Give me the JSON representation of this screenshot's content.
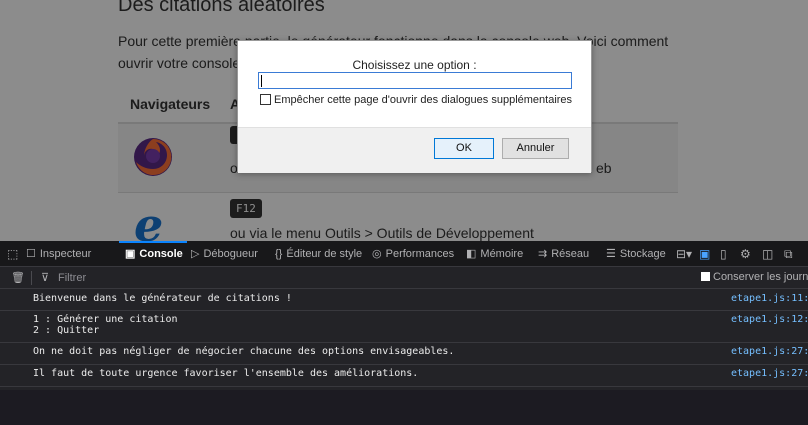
{
  "page": {
    "heading": "Des citations aléatoires",
    "intro_line1": "Pour cette première partie, le générateur fonctionne dans la console web. Voici comment",
    "intro_line2": "ouvrir votre console",
    "table": {
      "header_browsers": "Navigateurs",
      "header_second": "A",
      "row1_text": "o",
      "row1_tail": "eb",
      "row2_key": "F12",
      "row2_text": "ou via le menu Outils > Outils de Développement"
    }
  },
  "dialog": {
    "title": "Choisissez une option :",
    "input_value": "",
    "checkbox_label": "Empêcher cette page d'ouvrir des dialogues supplémentaires",
    "checkbox_checked": false,
    "ok_label": "OK",
    "cancel_label": "Annuler"
  },
  "devtools": {
    "tabs": [
      {
        "label": "Inspecteur",
        "icon": "inspector-icon",
        "active": false
      },
      {
        "label": "Console",
        "icon": "console-icon",
        "active": true
      },
      {
        "label": "Débogueur",
        "icon": "debugger-icon",
        "active": false
      },
      {
        "label": "Éditeur de style",
        "icon": "style-editor-icon",
        "active": false
      },
      {
        "label": "Performances",
        "icon": "performance-icon",
        "active": false
      },
      {
        "label": "Mémoire",
        "icon": "memory-icon",
        "active": false
      },
      {
        "label": "Réseau",
        "icon": "network-icon",
        "active": false
      },
      {
        "label": "Stockage",
        "icon": "storage-icon",
        "active": false
      }
    ],
    "filter_placeholder": "Filtrer",
    "persist_label": "Conserver les journa",
    "messages": [
      {
        "text": "Bienvenue dans le générateur de citations !",
        "source": "etape1.js:11:"
      },
      {
        "text": "1 : Générer une citation",
        "text2": "2 : Quitter",
        "source": "etape1.js:12:"
      },
      {
        "text": "On ne doit pas négliger de négocier chacune des options envisageables.",
        "source": "etape1.js:27:"
      },
      {
        "text": "Il faut de toute urgence favoriser l'ensemble des améliorations.",
        "source": "etape1.js:27:"
      }
    ]
  }
}
